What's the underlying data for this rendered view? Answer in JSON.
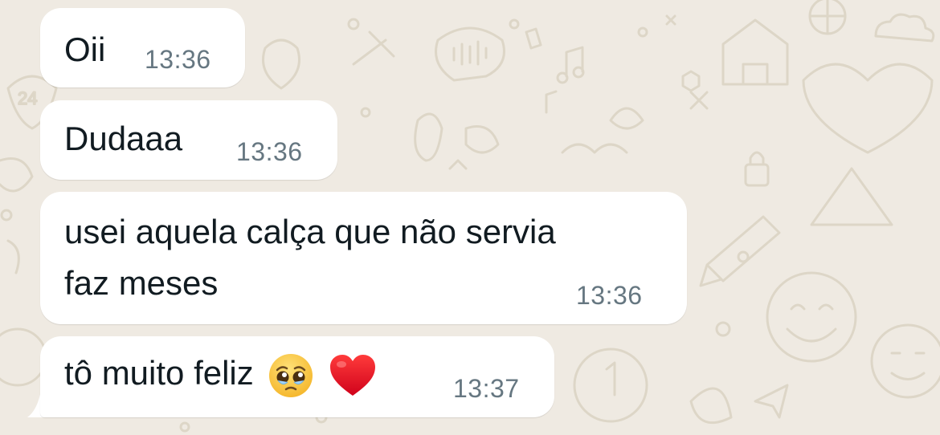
{
  "messages": [
    {
      "text": "Oii",
      "time": "13:36"
    },
    {
      "text": "Dudaaa",
      "time": "13:36"
    },
    {
      "lines": [
        "usei aquela calça que não servia",
        "faz meses"
      ],
      "time": "13:36"
    },
    {
      "text": "tô muito feliz",
      "emojis": [
        "pleading-face-emoji",
        "red-heart-emoji"
      ],
      "time": "13:37"
    }
  ],
  "colors": {
    "background": "#efeae2",
    "bubble": "#ffffff",
    "text": "#111b21",
    "time": "#667781",
    "doodle": "#dcd5c6"
  }
}
